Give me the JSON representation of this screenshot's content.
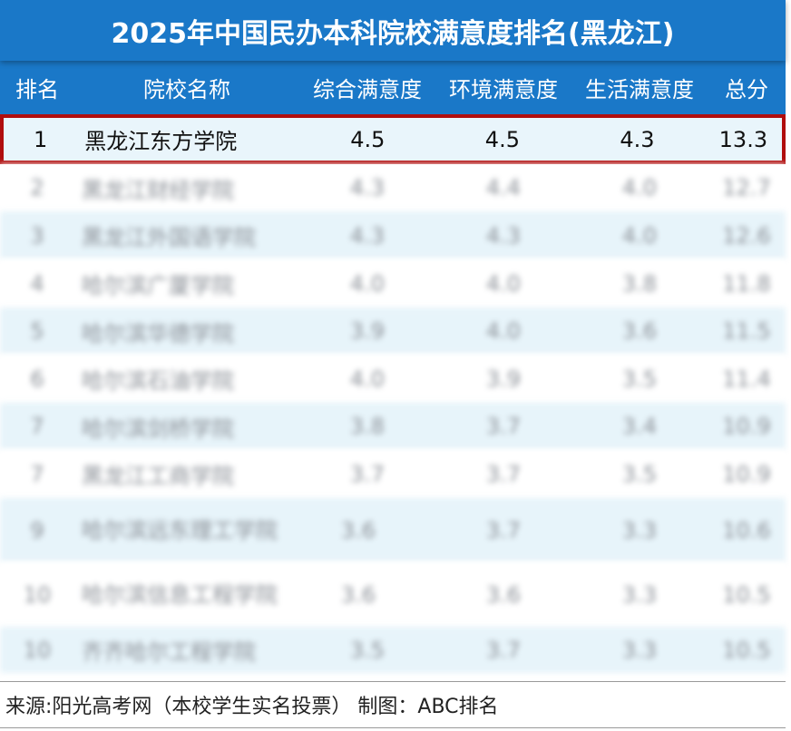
{
  "title": "2025年中国民办本科院校满意度排名(黑龙江)",
  "columns": [
    "排名",
    "院校名称",
    "综合满意度",
    "环境满意度",
    "生活满意度",
    "总分"
  ],
  "rows": [
    {
      "rank": "1",
      "name": "黑龙江东方学院",
      "overall": "4.5",
      "environment": "4.5",
      "life": "4.3",
      "total": "13.3"
    },
    {
      "rank": "2",
      "name": "黑龙江财经学院",
      "overall": "4.3",
      "environment": "4.4",
      "life": "4.0",
      "total": "12.7"
    },
    {
      "rank": "3",
      "name": "黑龙江外国语学院",
      "overall": "4.3",
      "environment": "4.3",
      "life": "4.0",
      "total": "12.6"
    },
    {
      "rank": "4",
      "name": "哈尔滨广厦学院",
      "overall": "4.0",
      "environment": "4.0",
      "life": "3.8",
      "total": "11.8"
    },
    {
      "rank": "5",
      "name": "哈尔滨华德学院",
      "overall": "3.9",
      "environment": "4.0",
      "life": "3.6",
      "total": "11.5"
    },
    {
      "rank": "6",
      "name": "哈尔滨石油学院",
      "overall": "4.0",
      "environment": "3.9",
      "life": "3.5",
      "total": "11.4"
    },
    {
      "rank": "7",
      "name": "哈尔滨剑桥学院",
      "overall": "3.8",
      "environment": "3.7",
      "life": "3.4",
      "total": "10.9"
    },
    {
      "rank": "7",
      "name": "黑龙江工商学院",
      "overall": "3.7",
      "environment": "3.7",
      "life": "3.5",
      "total": "10.9"
    },
    {
      "rank": "9",
      "name": "哈尔滨远东理工学院",
      "overall": "3.6",
      "environment": "3.7",
      "life": "3.3",
      "total": "10.6"
    },
    {
      "rank": "10",
      "name": "哈尔滨信息工程学院",
      "overall": "3.6",
      "environment": "3.6",
      "life": "3.3",
      "total": "10.5"
    },
    {
      "rank": "10",
      "name": "齐齐哈尔工程学院",
      "overall": "3.5",
      "environment": "3.7",
      "life": "3.3",
      "total": "10.5"
    }
  ],
  "source": "来源:阳光高考网（本校学生实名投票） 制图：ABC排名",
  "colors": {
    "header_bg": "#1a78c8",
    "highlight_border": "#b00d0d",
    "row_alt": "#e7f4fa"
  }
}
